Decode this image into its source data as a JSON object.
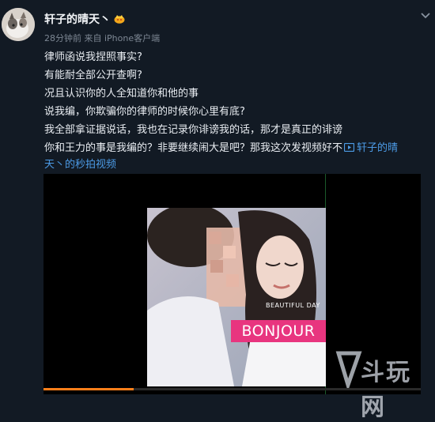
{
  "post": {
    "username": "轩子的晴天丶",
    "meta": "28分钟前 来自 iPhone客户端",
    "lines": [
      "律师函说我捏照事实?",
      "有能耐全部公开查啊?",
      "况且认识你的人全知道你和他的事",
      "说我编，你欺骗你的律师的时候你心里有底?",
      "我全部拿证据说话，我也在记录你诽谤我的话，那才是真正的诽谤",
      "你和王力的事是我编的？非要继续闹大是吧？那我这次发视频好不"
    ],
    "video_link_part1": "轩子的晴",
    "video_link_part2": "天丶的秒拍视频"
  },
  "video": {
    "overlay_small": "BEAUTIFUL DAY",
    "overlay_big": "BONJOUR",
    "progress": 0.24
  },
  "watermark": "斗玩网",
  "colors": {
    "background": "#121a24",
    "link": "#4c9be6",
    "accent_pink": "#e8357f",
    "progress": "#ff7f1a"
  },
  "icons": {
    "vip": "vip-crown-icon",
    "chevron": "chevron-down-icon",
    "video_link": "video-link-icon"
  }
}
